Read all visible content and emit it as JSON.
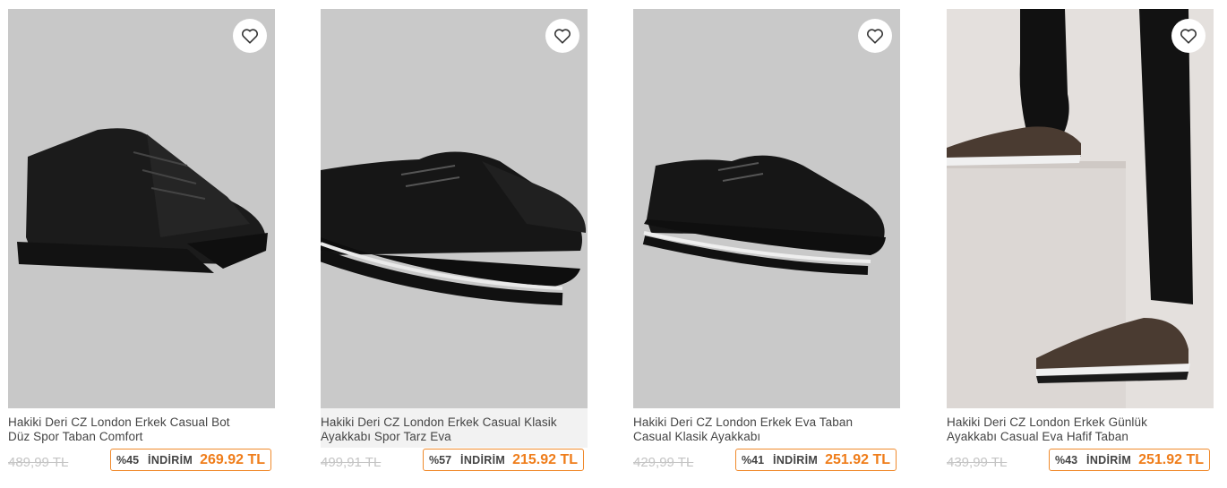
{
  "products": [
    {
      "title_line1": "Hakiki Deri CZ London Erkek Casual Bot",
      "title_line2": "Düz Spor Taban Comfort",
      "old_price": "489,99 TL",
      "discount": "%45",
      "discount_label": "İNDİRİM",
      "price": "269.92 TL"
    },
    {
      "title_line1": "Hakiki Deri CZ London Erkek Casual Klasik",
      "title_line2": "Ayakkabı Spor Tarz Eva",
      "old_price": "499,91 TL",
      "discount": "%57",
      "discount_label": "İNDİRİM",
      "price": "215.92 TL"
    },
    {
      "title_line1": "Hakiki Deri CZ London Erkek Eva Taban",
      "title_line2": "Casual Klasik Ayakkabı",
      "old_price": "429,99 TL",
      "discount": "%41",
      "discount_label": "İNDİRİM",
      "price": "251.92 TL"
    },
    {
      "title_line1": "Hakiki Deri CZ London Erkek Günlük",
      "title_line2": "Ayakkabı Casual Eva Hafif Taban",
      "old_price": "439,99 TL",
      "discount": "%43",
      "discount_label": "İNDİRİM",
      "price": "251.92 TL"
    }
  ],
  "icons": {
    "favorite": "heart-outline-icon"
  },
  "colors": {
    "accent": "#ef7d1a",
    "badge_border": "#f08a2c",
    "old_price": "#c4c4c4"
  }
}
